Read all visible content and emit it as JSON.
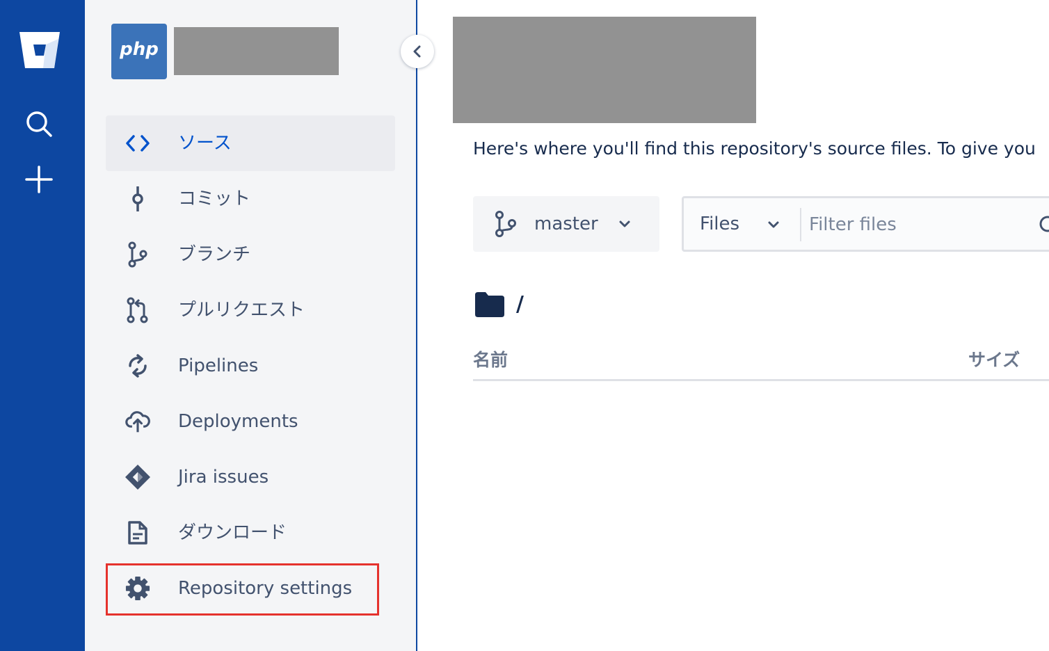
{
  "colors": {
    "global_nav_bg": "#0D47A1",
    "sidebar_bg": "#F4F5F7",
    "active_item_bg": "#EBECF0",
    "active_text": "#0052CC",
    "nav_text": "#42526E",
    "highlight": "#E5322D",
    "redacted": "#929292"
  },
  "global_nav": {
    "icons": [
      "bitbucket-logo-icon",
      "search-icon",
      "create-plus-icon"
    ]
  },
  "sidebar": {
    "repo_avatar_text": "php",
    "items": [
      {
        "label": "ソース",
        "icon": "code-icon",
        "active": true
      },
      {
        "label": "コミット",
        "icon": "commit-icon"
      },
      {
        "label": "ブランチ",
        "icon": "branch-icon"
      },
      {
        "label": "プルリクエスト",
        "icon": "pull-request-icon"
      },
      {
        "label": "Pipelines",
        "icon": "pipelines-icon"
      },
      {
        "label": "Deployments",
        "icon": "cloud-upload-icon"
      },
      {
        "label": "Jira issues",
        "icon": "jira-icon"
      },
      {
        "label": "ダウンロード",
        "icon": "document-icon"
      },
      {
        "label": "Repository settings",
        "icon": "gear-icon",
        "highlighted": true
      }
    ]
  },
  "main": {
    "intro": "Here's where you'll find this repository's source files. To give you",
    "branch": "master",
    "files_dropdown": "Files",
    "filter_placeholder": "Filter files",
    "path": "/",
    "columns": {
      "name": "名前",
      "size": "サイズ"
    }
  }
}
